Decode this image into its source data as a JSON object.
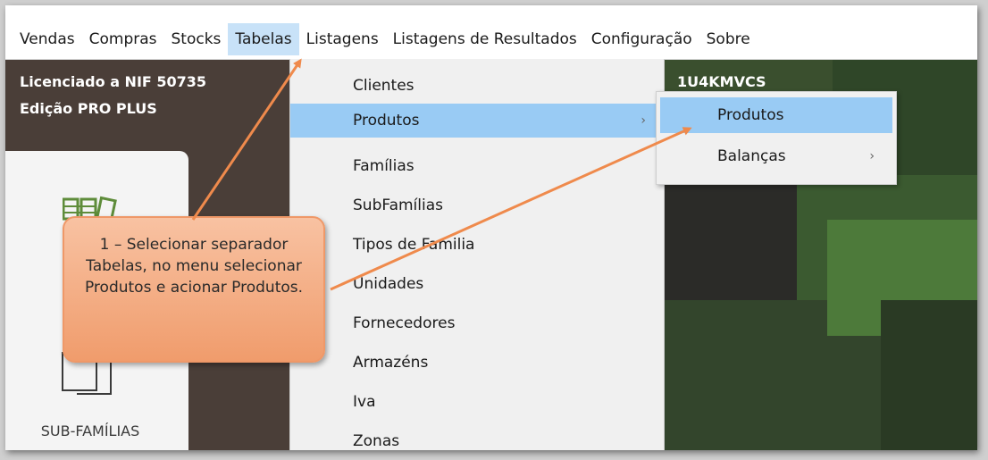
{
  "menubar": {
    "items": [
      "Vendas",
      "Compras",
      "Stocks",
      "Tabelas",
      "Listagens",
      "Listagens de Resultados",
      "Configuração",
      "Sobre"
    ],
    "active_index": 3
  },
  "license": {
    "line1": "Licenciado a NIF 50735",
    "line2": "Edição PRO PLUS",
    "serial": "1U4KMVCS"
  },
  "card": {
    "label": "SUB-FAMÍLIAS",
    "icon": "folder-icon"
  },
  "dropdown": {
    "items": [
      "Clientes",
      "Produtos",
      "Famílias",
      "SubFamílias",
      "Tipos de Familia",
      "Unidades",
      "Fornecedores",
      "Armazéns",
      "Iva",
      "Zonas"
    ],
    "highlighted_index": 1
  },
  "submenu": {
    "items": [
      "Produtos",
      "Balanças"
    ],
    "highlighted_index": 0
  },
  "callout": {
    "text": "1 – Selecionar separador Tabelas, no menu selecionar Produtos e acionar Produtos."
  },
  "colors": {
    "menu_highlight": "#99cbf4",
    "tab_active": "#c8e2f8",
    "callout_fill": "#f4ad85",
    "arrow": "#ef8a4c"
  }
}
